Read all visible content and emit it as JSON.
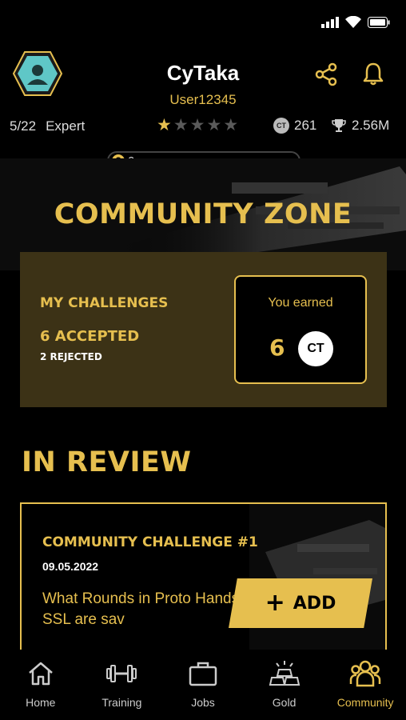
{
  "colors": {
    "accent": "#e6bf4f",
    "panel": "#3c3216",
    "background": "#000000"
  },
  "profile": {
    "name": "CyTaka",
    "user_id": "User12345",
    "rank": "5/22",
    "level": "Expert",
    "stars": {
      "filled": 1,
      "total": 5
    },
    "coins": "261",
    "trophies": "2.56M",
    "progress": "0",
    "coin_symbol": "CT"
  },
  "community": {
    "title": "COMMUNITY ZONE",
    "challenges_title": "MY CHALLENGES",
    "accepted": "6 ACCEPTED",
    "rejected": "2 REJECTED",
    "earned_label": "You earned",
    "earned_value": "6",
    "currency": "CT"
  },
  "review": {
    "title": "IN REVIEW",
    "card": {
      "title": "COMMUNITY CHALLENGE #1",
      "date": "09.05.2022",
      "question": "What Rounds in Proto Handshake SSL are sav"
    },
    "add_label": "ADD"
  },
  "nav": [
    {
      "label": "Home",
      "icon": "home-icon",
      "active": false
    },
    {
      "label": "Training",
      "icon": "dumbbell-icon",
      "active": false
    },
    {
      "label": "Jobs",
      "icon": "briefcase-icon",
      "active": false
    },
    {
      "label": "Gold",
      "icon": "gold-icon",
      "active": false
    },
    {
      "label": "Community",
      "icon": "community-icon",
      "active": true
    }
  ]
}
